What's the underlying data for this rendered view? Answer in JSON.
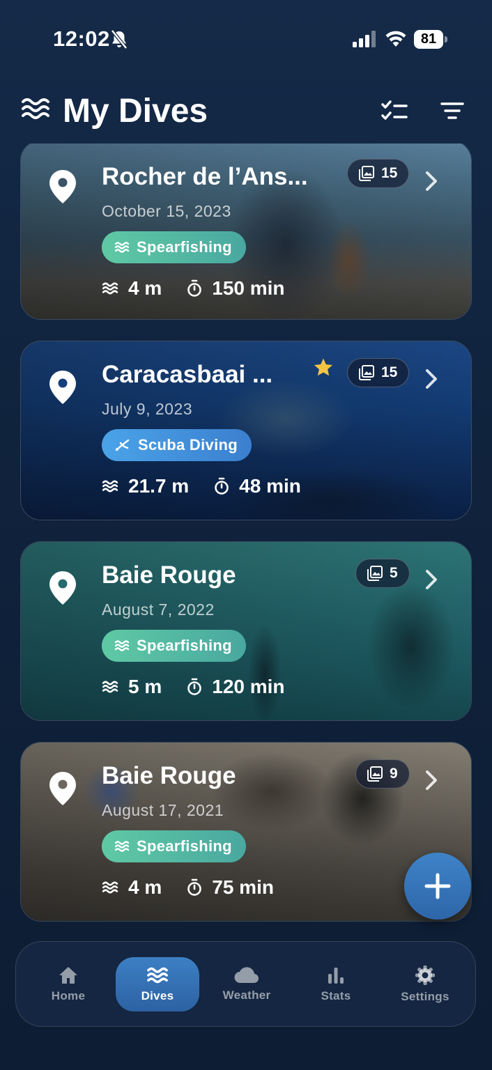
{
  "status_bar": {
    "time": "12:02",
    "battery": "81"
  },
  "header": {
    "title": "My Dives"
  },
  "dives": [
    {
      "name": "Rocher de l’Ans...",
      "date": "October 15, 2023",
      "type": "Spearfishing",
      "depth": "4 m",
      "duration": "150 min",
      "photos": "15",
      "favorite": false
    },
    {
      "name": "Caracasbaai ...",
      "date": "July 9, 2023",
      "type": "Scuba Diving",
      "depth": "21.7 m",
      "duration": "48 min",
      "photos": "15",
      "favorite": true
    },
    {
      "name": "Baie Rouge",
      "date": "August 7, 2022",
      "type": "Spearfishing",
      "depth": "5 m",
      "duration": "120 min",
      "photos": "5",
      "favorite": false
    },
    {
      "name": "Baie Rouge",
      "date": "August 17, 2021",
      "type": "Spearfishing",
      "depth": "4 m",
      "duration": "75 min",
      "photos": "9",
      "favorite": false
    }
  ],
  "tabs": [
    {
      "label": "Home",
      "icon": "home-icon"
    },
    {
      "label": "Dives",
      "icon": "waves-icon"
    },
    {
      "label": "Weather",
      "icon": "cloud-icon"
    },
    {
      "label": "Stats",
      "icon": "bar-chart-icon"
    },
    {
      "label": "Settings",
      "icon": "gear-icon"
    }
  ],
  "active_tab": "Dives",
  "colors": {
    "accent": "#3d7fc4",
    "spearfishing": "#5fc9a4",
    "scuba": "#4aa3e8",
    "star": "#f5c443"
  }
}
